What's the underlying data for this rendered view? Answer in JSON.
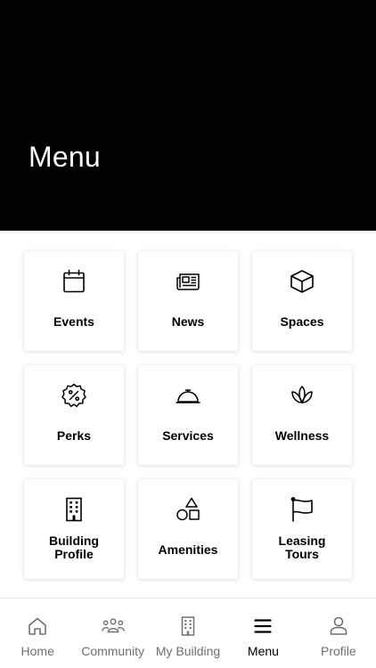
{
  "header": {
    "title": "Menu"
  },
  "menu": {
    "tiles": [
      {
        "label": "Events",
        "icon": "calendar-icon"
      },
      {
        "label": "News",
        "icon": "newspaper-icon"
      },
      {
        "label": "Spaces",
        "icon": "cube-icon"
      },
      {
        "label": "Perks",
        "icon": "discount-badge-icon"
      },
      {
        "label": "Services",
        "icon": "service-bell-icon"
      },
      {
        "label": "Wellness",
        "icon": "lotus-icon"
      },
      {
        "label": "Building\nProfile",
        "icon": "building-icon"
      },
      {
        "label": "Amenities",
        "icon": "shapes-icon"
      },
      {
        "label": "Leasing\nTours",
        "icon": "flag-icon"
      }
    ]
  },
  "tabbar": {
    "active": "Menu",
    "items": [
      {
        "label": "Home",
        "icon": "home-icon"
      },
      {
        "label": "Community",
        "icon": "people-icon"
      },
      {
        "label": "My Building",
        "icon": "building-icon"
      },
      {
        "label": "Menu",
        "icon": "hamburger-icon"
      },
      {
        "label": "Profile",
        "icon": "person-icon"
      }
    ]
  },
  "colors": {
    "header_bg": "#000000",
    "header_text": "#ffffff",
    "tab_inactive": "#707070",
    "tab_active": "#000000"
  }
}
